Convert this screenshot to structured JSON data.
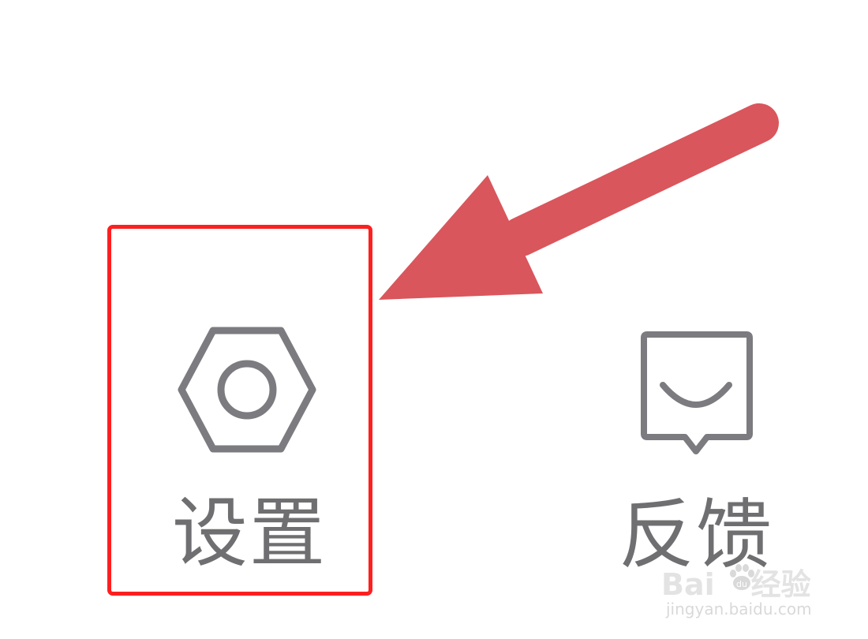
{
  "menu": {
    "items": [
      {
        "label": "设置",
        "icon": "settings-nut-icon"
      },
      {
        "label": "反馈",
        "icon": "feedback-bubble-icon"
      }
    ]
  },
  "annotation": {
    "highlight_color": "#ff1f1f",
    "arrow_color": "#d9565c",
    "highlighted_item": "设置"
  },
  "watermark": {
    "brand_prefix": "Bai",
    "brand_suffix": "经验",
    "site": "jingyan.baidu.com"
  },
  "colors": {
    "icon_gray": "#7b7b80",
    "label_gray": "#6f6f72",
    "background": "#ffffff"
  }
}
